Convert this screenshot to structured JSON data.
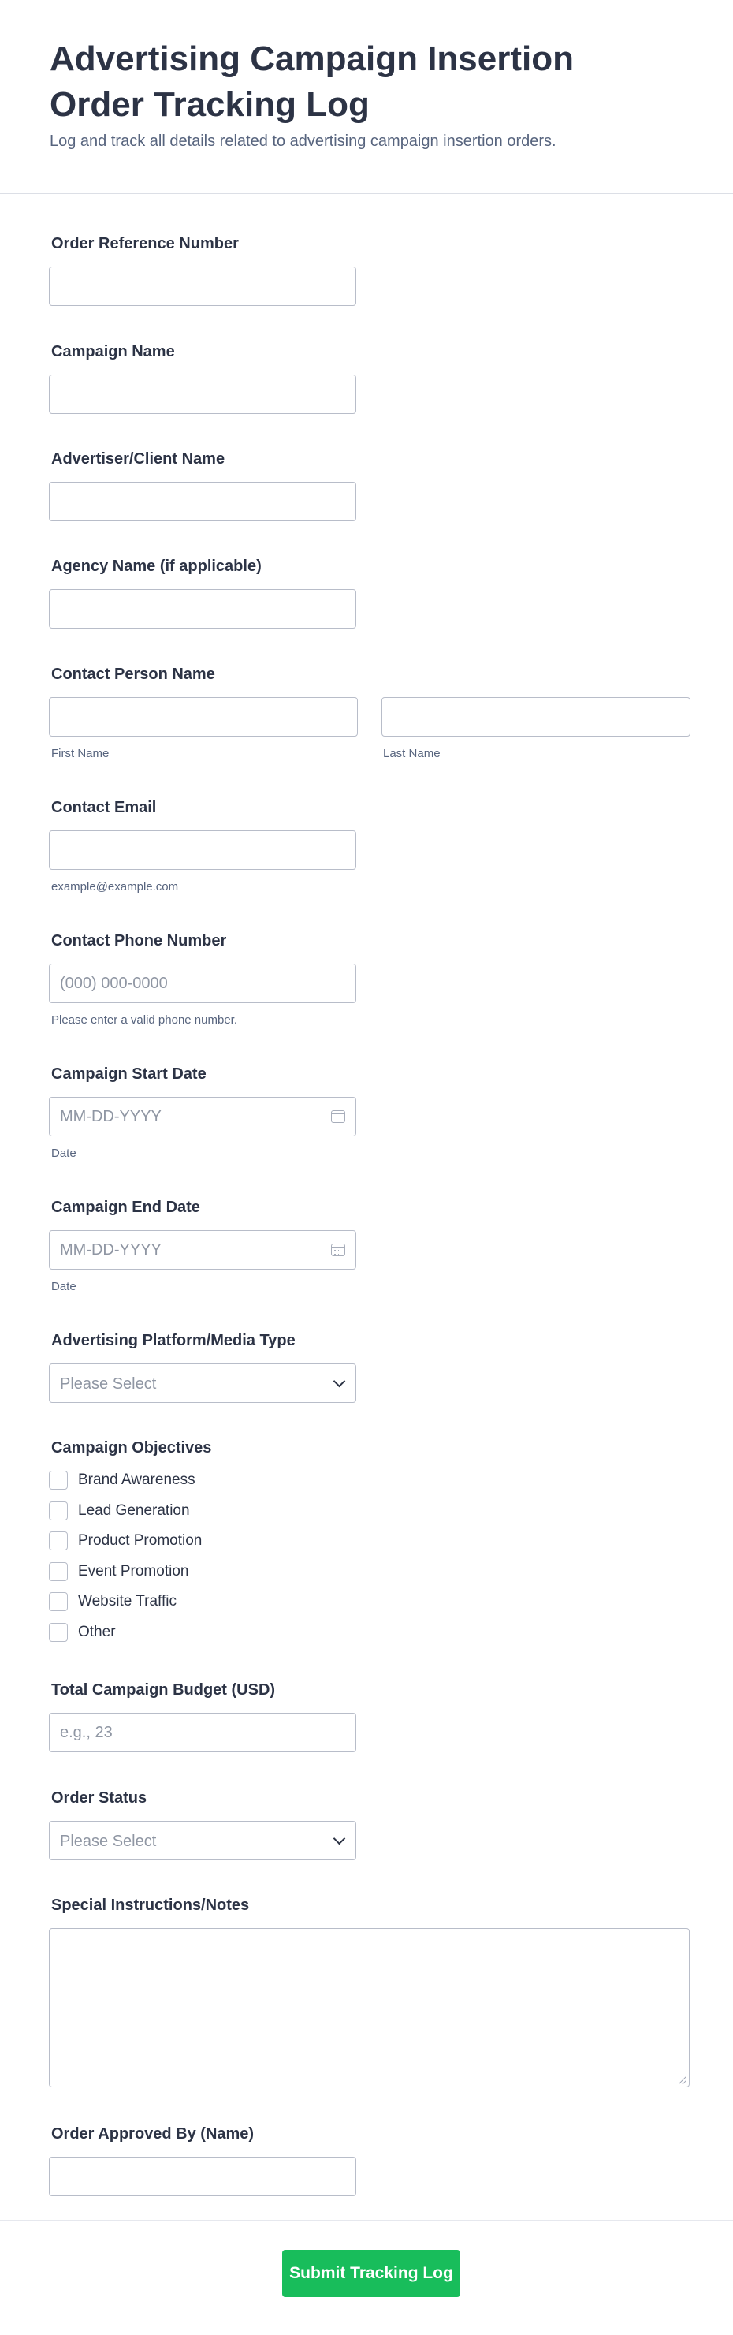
{
  "form": {
    "title": "Advertising Campaign Insertion Order Tracking Log",
    "subtitle": "Log and track all details related to advertising campaign insertion orders."
  },
  "fields": {
    "order_ref": {
      "label": "Order Reference Number",
      "value": ""
    },
    "campaign_name": {
      "label": "Campaign Name",
      "value": ""
    },
    "advertiser": {
      "label": "Advertiser/Client Name",
      "value": ""
    },
    "agency": {
      "label": "Agency Name (if applicable)",
      "value": ""
    },
    "contact_person": {
      "label": "Contact Person Name",
      "first_sublabel": "First Name",
      "last_sublabel": "Last Name"
    },
    "contact_email": {
      "label": "Contact Email",
      "sublabel": "example@example.com"
    },
    "contact_phone": {
      "label": "Contact Phone Number",
      "placeholder": "(000) 000-0000",
      "sublabel": "Please enter a valid phone number."
    },
    "start_date": {
      "label": "Campaign Start Date",
      "placeholder": "MM-DD-YYYY",
      "sublabel": "Date",
      "icon": "calendar-icon"
    },
    "end_date": {
      "label": "Campaign End Date",
      "placeholder": "MM-DD-YYYY",
      "sublabel": "Date",
      "icon": "calendar-icon"
    },
    "platform": {
      "label": "Advertising Platform/Media Type",
      "selected": "Please Select",
      "icon": "chevron-down-icon"
    },
    "objectives": {
      "label": "Campaign Objectives",
      "options": [
        "Brand Awareness",
        "Lead Generation",
        "Product Promotion",
        "Event Promotion",
        "Website Traffic",
        "Other"
      ]
    },
    "budget": {
      "label": "Total Campaign Budget (USD)",
      "placeholder": "e.g., 23"
    },
    "status": {
      "label": "Order Status",
      "selected": "Please Select",
      "icon": "chevron-down-icon"
    },
    "notes": {
      "label": "Special Instructions/Notes"
    },
    "approved_by": {
      "label": "Order Approved By (Name)"
    }
  },
  "submit": {
    "label": "Submit Tracking Log",
    "color": "#18bd5b"
  }
}
